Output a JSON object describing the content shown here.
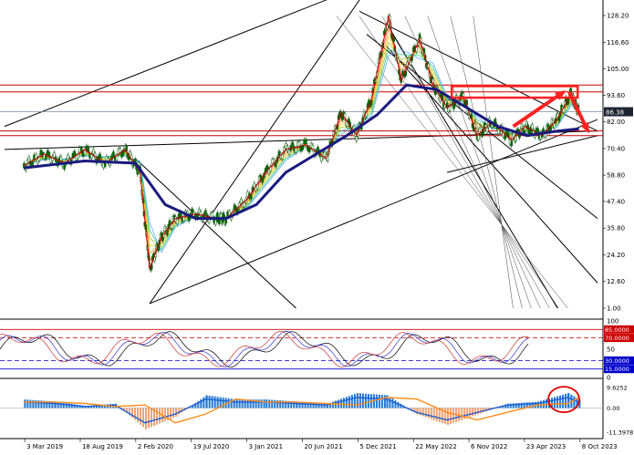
{
  "chart_data": {
    "type": "line",
    "title": "",
    "main_panel": {
      "price_scale": {
        "ticks": [
          "128.20",
          "116.60",
          "105.00",
          "93.60",
          "82.00",
          "70.40",
          "58.80",
          "47.40",
          "35.80",
          "24.20",
          "12.60",
          "1.00"
        ],
        "tick_values": [
          128.2,
          116.6,
          105.0,
          93.6,
          82.0,
          70.4,
          58.8,
          47.4,
          35.8,
          24.2,
          12.6,
          1.0
        ],
        "current_price_label": "86.38",
        "current_price": 86.38
      },
      "series": [
        {
          "name": "price",
          "color": "#006400",
          "x": [
            "2019-03-01",
            "2019-05-01",
            "2019-07-01",
            "2019-09-01",
            "2019-11-01",
            "2020-01-01",
            "2020-02-15",
            "2020-03-15",
            "2020-04-20",
            "2020-06-01",
            "2020-08-01",
            "2020-10-01",
            "2020-11-01",
            "2021-01-01",
            "2021-03-01",
            "2021-05-01",
            "2021-07-01",
            "2021-09-01",
            "2021-10-15",
            "2021-12-01",
            "2022-01-15",
            "2022-03-08",
            "2022-04-15",
            "2022-06-10",
            "2022-07-20",
            "2022-09-01",
            "2022-10-20",
            "2022-12-01",
            "2023-01-15",
            "2023-03-15",
            "2023-04-25",
            "2023-06-15",
            "2023-07-30",
            "2023-09-10",
            "2023-10-05"
          ],
          "values": [
            63,
            68,
            64,
            70,
            64,
            70,
            60,
            18,
            32,
            40,
            42,
            40,
            40,
            48,
            60,
            70,
            72,
            66,
            86,
            76,
            92,
            128,
            100,
            118,
            98,
            88,
            93,
            76,
            82,
            74,
            80,
            76,
            83,
            94,
            86
          ]
        },
        {
          "name": "moving_average",
          "color": "#1a1a80",
          "x": [
            "2019-03-01",
            "2019-09-01",
            "2020-02-01",
            "2020-05-01",
            "2020-08-01",
            "2020-11-01",
            "2021-02-01",
            "2021-05-01",
            "2021-08-01",
            "2021-11-01",
            "2022-02-01",
            "2022-05-01",
            "2022-08-01",
            "2022-11-01",
            "2023-02-01",
            "2023-05-01",
            "2023-08-01",
            "2023-10-05"
          ],
          "values": [
            62,
            65,
            64,
            46,
            40,
            40,
            46,
            60,
            68,
            76,
            85,
            98,
            96,
            88,
            80,
            76,
            78,
            79
          ]
        }
      ],
      "annotations": {
        "horizontal_lines": [
          98,
          95,
          78,
          76
        ],
        "resistance_zone": {
          "from": "2022-09-15",
          "to": "2023-10-01",
          "low": 92.5,
          "high": 97.5
        },
        "arrow_up": {
          "x0": "2023-03-20",
          "y0": 80,
          "x1": "2023-08-20",
          "y1": 95
        },
        "arrow_down": {
          "x0": "2023-09-05",
          "y0": 95,
          "x1": "2023-11-01",
          "y1": 78
        }
      }
    },
    "rsi_panel": {
      "ticks": [
        "100",
        "85.0000",
        "70.0000",
        "50",
        "30.0000",
        "15.0000",
        "0"
      ],
      "tick_values": [
        100,
        85,
        70,
        50,
        30,
        15,
        0
      ],
      "level_colors": {
        "85": "#cc0000",
        "70": "#cc0000",
        "30": "#0000cc",
        "15": "#0000cc"
      }
    },
    "macd_panel": {
      "ticks": [
        "9.6252",
        "0.00",
        "-11.3978"
      ],
      "tick_values": [
        9.6252,
        0.0,
        -11.3978
      ],
      "histogram": {
        "x": [
          "2019-03-01",
          "2019-06-01",
          "2019-09-01",
          "2019-12-01",
          "2020-03-01",
          "2020-06-01",
          "2020-09-01",
          "2020-12-01",
          "2021-03-01",
          "2021-06-01",
          "2021-09-01",
          "2021-12-01",
          "2022-03-01",
          "2022-06-01",
          "2022-09-01",
          "2022-12-01",
          "2023-03-01",
          "2023-06-01",
          "2023-09-01",
          "2023-10-05"
        ],
        "values": [
          4,
          3,
          1,
          2,
          -10,
          -4,
          6,
          4,
          4,
          3,
          2,
          7,
          6,
          -3,
          -8,
          -3,
          2,
          3,
          7,
          4
        ]
      },
      "positive_color": "#1f77d4",
      "negative_color": "#f4a070"
    },
    "x_axis": {
      "labels": [
        "3 Mar 2019",
        "18 Aug 2019",
        "2 Feb 2020",
        "19 Jul 2020",
        "3 Jan 2021",
        "20 Jun 2021",
        "5 Dec 2021",
        "22 May 2022",
        "6 Nov 2022",
        "23 Apr 2023",
        "8 Oct 2023"
      ],
      "dates": [
        "2019-03-03",
        "2019-08-18",
        "2020-02-02",
        "2020-07-19",
        "2021-01-03",
        "2021-06-20",
        "2021-12-05",
        "2022-05-22",
        "2022-11-06",
        "2023-04-23",
        "2023-10-08"
      ]
    },
    "colors": {
      "candle": "#006400",
      "moving_average": "#1a1a80",
      "zigzag": "#cc0000",
      "annotation": "#ff2020",
      "channel": "#000000"
    },
    "grid": false
  }
}
